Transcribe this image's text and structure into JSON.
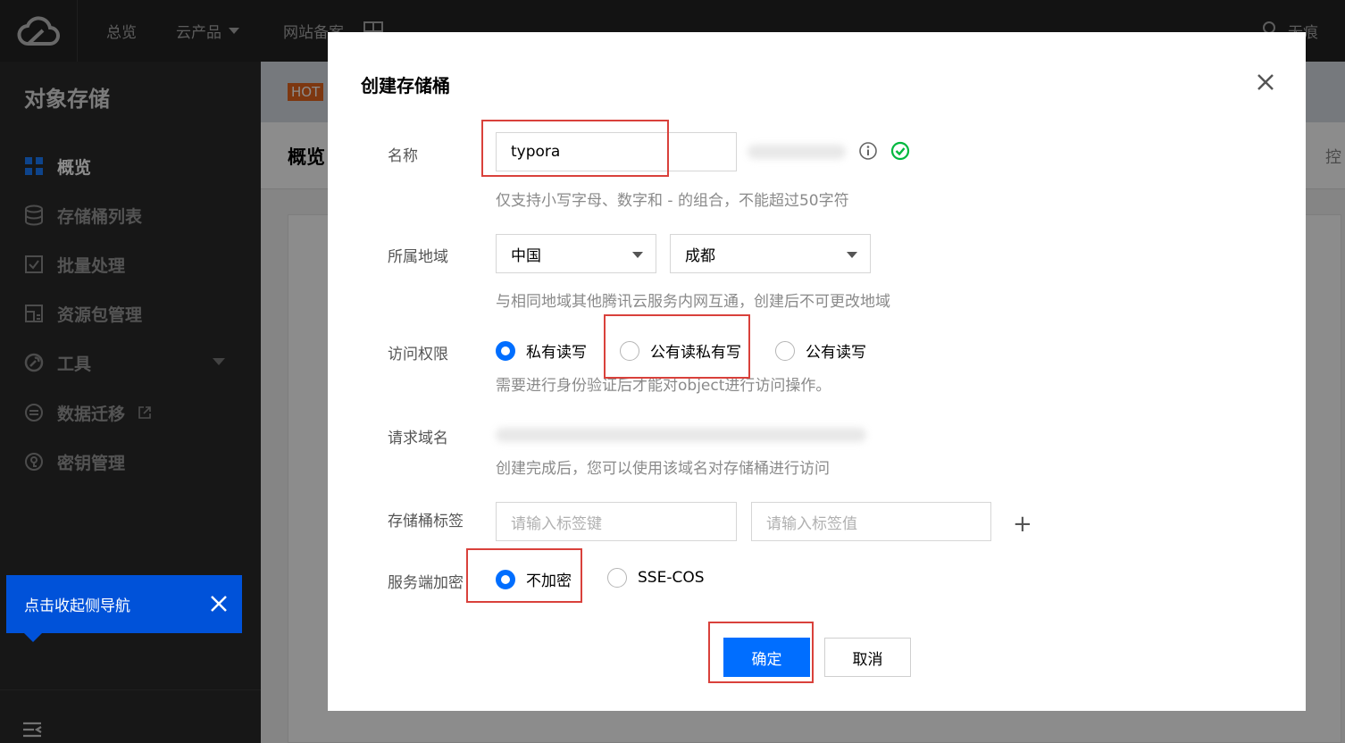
{
  "topbar": {
    "nav": [
      "总览",
      "云产品",
      "网站备案"
    ],
    "user_name": "无痕"
  },
  "sidebar": {
    "title": "对象存储",
    "items": [
      {
        "label": "概览",
        "icon": "grid-icon",
        "active": true
      },
      {
        "label": "存储桶列表",
        "icon": "bucket-icon",
        "active": false
      },
      {
        "label": "批量处理",
        "icon": "checkbox-icon",
        "active": false
      },
      {
        "label": "资源包管理",
        "icon": "package-icon",
        "active": false
      },
      {
        "label": "工具",
        "icon": "wrench-icon",
        "active": false
      },
      {
        "label": "数据迁移",
        "icon": "migrate-icon",
        "active": false
      },
      {
        "label": "密钥管理",
        "icon": "key-icon",
        "active": false
      }
    ],
    "collapse_tip": "点击收起侧导航"
  },
  "background": {
    "hot_badge": "HOT",
    "page_title": "概览",
    "right_label": "控"
  },
  "dialog": {
    "title": "创建存储桶",
    "name": {
      "label": "名称",
      "value": "typora",
      "hint": "仅支持小写字母、数字和 - 的组合，不能超过50字符"
    },
    "region": {
      "label": "所属地域",
      "country": "中国",
      "city": "成都",
      "hint": "与相同地域其他腾讯云服务内网互通，创建后不可更改地域"
    },
    "access": {
      "label": "访问权限",
      "options": [
        "私有读写",
        "公有读私有写",
        "公有读写"
      ],
      "selected_index": 0,
      "hint": "需要进行身份验证后才能对object进行访问操作。"
    },
    "domain": {
      "label": "请求域名",
      "hint": "创建完成后，您可以使用该域名对存储桶进行访问"
    },
    "tags": {
      "label": "存储桶标签",
      "key_placeholder": "请输入标签键",
      "value_placeholder": "请输入标签值"
    },
    "encryption": {
      "label": "服务端加密",
      "options": [
        "不加密",
        "SSE-COS"
      ],
      "selected_index": 0
    },
    "confirm_label": "确定",
    "cancel_label": "取消"
  },
  "colors": {
    "primary": "#006eff",
    "sidebar_bg": "#2b2b2b",
    "topbar_bg": "#232323",
    "highlight_box": "#d9413b",
    "success": "#00b83f"
  }
}
